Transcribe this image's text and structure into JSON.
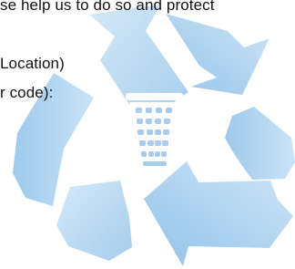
{
  "document": {
    "lines": [
      "se help us to do so and protect",
      "Location)",
      "r code):"
    ]
  },
  "graphic": {
    "name": "recycling-symbol-with-wastebasket",
    "colors": {
      "arrow_light": "#c6e1f5",
      "arrow_mid": "#a8cdec",
      "arrow_dark": "#8bbde6",
      "basket": "#ffffff"
    }
  }
}
